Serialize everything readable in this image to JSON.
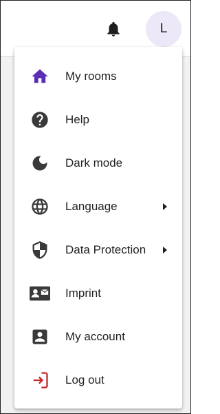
{
  "header": {
    "notification_icon": "bell-icon",
    "avatar_initial": "L",
    "avatar_bg": "#ece8f7"
  },
  "menu": {
    "accent_color": "#5b2fb5",
    "logout_color": "#c62828",
    "items": [
      {
        "label": "My rooms",
        "icon": "home-icon",
        "has_submenu": false
      },
      {
        "label": "Help",
        "icon": "help-circle-icon",
        "has_submenu": false
      },
      {
        "label": "Dark mode",
        "icon": "moon-icon",
        "has_submenu": false
      },
      {
        "label": "Language",
        "icon": "globe-icon",
        "has_submenu": true
      },
      {
        "label": "Data Protection",
        "icon": "shield-icon",
        "has_submenu": true
      },
      {
        "label": "Imprint",
        "icon": "contact-card-icon",
        "has_submenu": false
      },
      {
        "label": "My account",
        "icon": "account-box-icon",
        "has_submenu": false
      },
      {
        "label": "Log out",
        "icon": "logout-icon",
        "has_submenu": false
      }
    ]
  }
}
